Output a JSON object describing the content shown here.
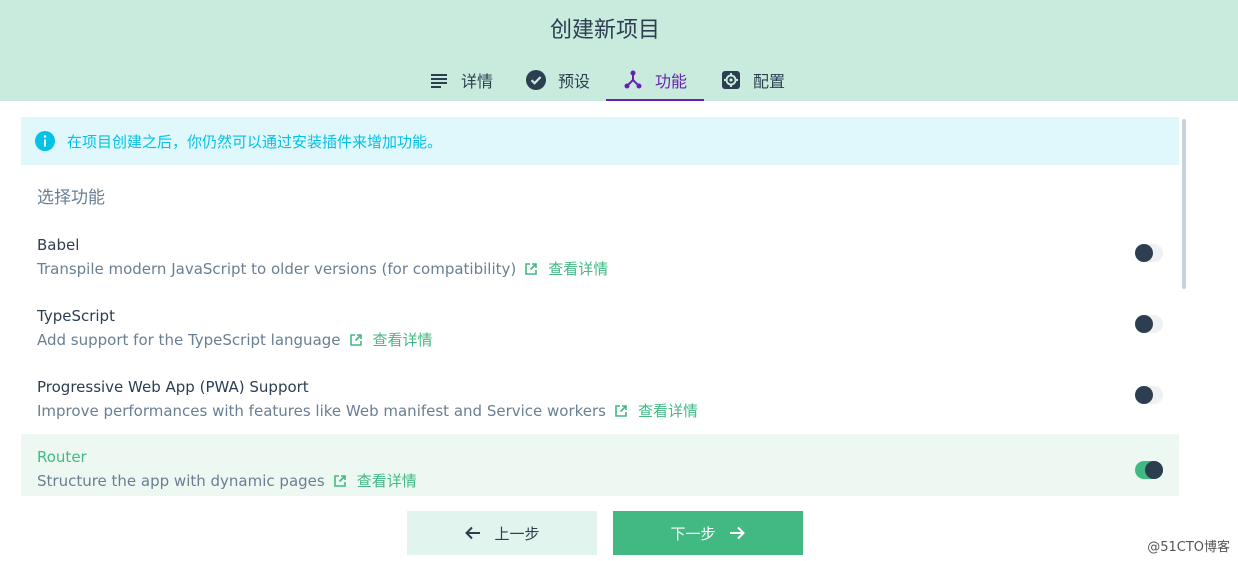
{
  "header": {
    "title": "创建新项目",
    "tabs": [
      {
        "label": "详情",
        "icon": "list-icon",
        "active": false
      },
      {
        "label": "预设",
        "icon": "check-circle-icon",
        "active": false
      },
      {
        "label": "功能",
        "icon": "fork-icon",
        "active": true
      },
      {
        "label": "配置",
        "icon": "settings-icon",
        "active": false
      }
    ]
  },
  "info": {
    "icon": "info-icon",
    "text": "在项目创建之后，你仍然可以通过安装插件来增加功能。"
  },
  "section_title": "选择功能",
  "features": [
    {
      "name": "Babel",
      "description": "Transpile modern JavaScript to older versions (for compatibility)",
      "link_label": "查看详情",
      "enabled": false
    },
    {
      "name": "TypeScript",
      "description": "Add support for the TypeScript language",
      "link_label": "查看详情",
      "enabled": false
    },
    {
      "name": "Progressive Web App (PWA) Support",
      "description": "Improve performances with features like Web manifest and Service workers",
      "link_label": "查看详情",
      "enabled": false
    },
    {
      "name": "Router",
      "description": "Structure the app with dynamic pages",
      "link_label": "查看详情",
      "enabled": true
    }
  ],
  "footer": {
    "prev_label": "上一步",
    "next_label": "下一步"
  },
  "watermark": "@51CTO博客",
  "colors": {
    "header_bg": "#c8ebde",
    "accent": "#42b983",
    "tab_active": "#6a1fb3",
    "info": "#03c2e6"
  }
}
